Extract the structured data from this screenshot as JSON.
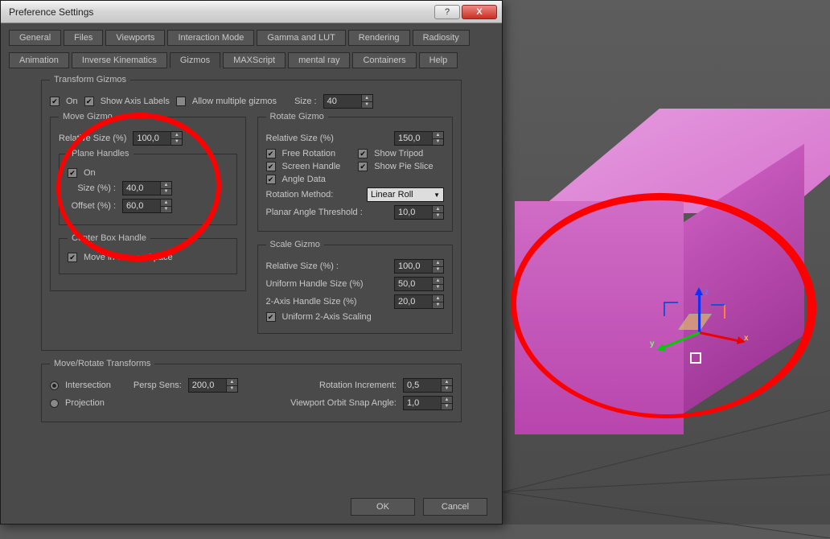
{
  "window": {
    "title": "Preference Settings",
    "help": "?",
    "close": "X"
  },
  "tabs_row1": [
    "General",
    "Files",
    "Viewports",
    "Interaction Mode",
    "Gamma and LUT",
    "Rendering",
    "Radiosity"
  ],
  "tabs_row2": [
    "Animation",
    "Inverse Kinematics",
    "Gizmos",
    "MAXScript",
    "mental ray",
    "Containers",
    "Help"
  ],
  "active_tab": "Gizmos",
  "transform_gizmos": {
    "legend": "Transform Gizmos",
    "on": "On",
    "show_axis": "Show Axis Labels",
    "allow_multiple": "Allow multiple gizmos",
    "size_label": "Size :",
    "size_value": "40"
  },
  "move_gizmo": {
    "legend": "Move Gizmo",
    "rel_size_label": "Relative Size (%)",
    "rel_size_value": "100,0",
    "plane_handles": {
      "legend": "Plane Handles",
      "on": "On",
      "size_label": "Size (%) :",
      "size_value": "40,0",
      "offset_label": "Offset (%) :",
      "offset_value": "60,0"
    },
    "center_box": {
      "legend": "Center Box Handle",
      "move_screen": "Move in Screen Space"
    }
  },
  "rotate_gizmo": {
    "legend": "Rotate Gizmo",
    "rel_size_label": "Relative Size (%)",
    "rel_size_value": "150,0",
    "free_rotation": "Free Rotation",
    "show_tripod": "Show Tripod",
    "screen_handle": "Screen Handle",
    "show_pie": "Show Pie Slice",
    "angle_data": "Angle Data",
    "rotation_method_label": "Rotation Method:",
    "rotation_method_value": "Linear Roll",
    "planar_label": "Planar Angle Threshold :",
    "planar_value": "10,0"
  },
  "scale_gizmo": {
    "legend": "Scale Gizmo",
    "rel_size_label": "Relative Size (%) :",
    "rel_size_value": "100,0",
    "uniform_label": "Uniform Handle Size (%)",
    "uniform_value": "50,0",
    "two_axis_label": "2-Axis Handle Size (%)",
    "two_axis_value": "20,0",
    "uniform_scaling": "Uniform 2-Axis Scaling"
  },
  "move_rotate": {
    "legend": "Move/Rotate Transforms",
    "intersection": "Intersection",
    "projection": "Projection",
    "persp_label": "Persp Sens:",
    "persp_value": "200,0",
    "rot_inc_label": "Rotation Increment:",
    "rot_inc_value": "0,5",
    "orbit_label": "Viewport Orbit Snap Angle:",
    "orbit_value": "1,0"
  },
  "buttons": {
    "ok": "OK",
    "cancel": "Cancel"
  },
  "gizmo_labels": {
    "x": "x",
    "y": "y",
    "z": "z"
  }
}
